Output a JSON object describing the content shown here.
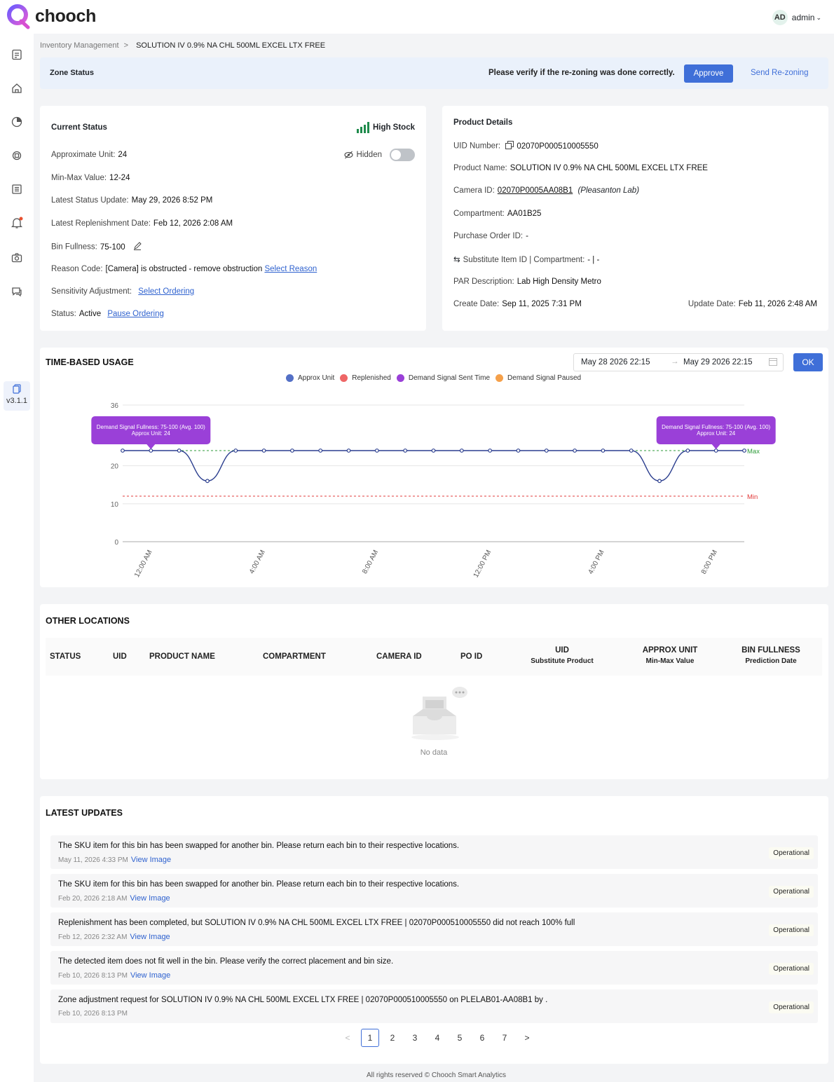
{
  "app": {
    "logo_text": "chooch",
    "user_initials": "AD",
    "user_name": "admin",
    "version": "v3.1.1"
  },
  "breadcrumb": {
    "parent": "Inventory Management",
    "separator": ">",
    "current": "SOLUTION IV 0.9% NA CHL 500ML EXCEL LTX FREE"
  },
  "zone_status": {
    "title": "Zone Status",
    "message": "Please verify if the re-zoning was done correctly.",
    "approve_label": "Approve",
    "send_label": "Send Re-zoning"
  },
  "current_status": {
    "title": "Current Status",
    "stock_label": "High Stock",
    "hidden_label": "Hidden",
    "approx_unit_label": "Approximate Unit:",
    "approx_unit": "24",
    "minmax_label": "Min-Max Value:",
    "minmax": "12-24",
    "latest_update_label": "Latest Status Update:",
    "latest_update": "May 29, 2026 8:52 PM",
    "replenish_label": "Latest Replenishment Date:",
    "replenish": "Feb 12, 2026 2:08 AM",
    "fullness_label": "Bin Fullness:",
    "fullness": "75-100",
    "reason_label": "Reason Code:",
    "reason": "[Camera] is obstructed - remove obstruction",
    "reason_link": "Select Reason",
    "sensitivity_label": "Sensitivity Adjustment:",
    "sensitivity_link": "Select Ordering",
    "status_label": "Status:",
    "status": "Active",
    "status_link": "Pause Ordering"
  },
  "product_details": {
    "title": "Product Details",
    "uid_label": "UID Number:",
    "uid": "02070P000510005550",
    "name_label": "Product Name:",
    "name": "SOLUTION IV 0.9% NA CHL 500ML EXCEL LTX FREE",
    "camera_label": "Camera ID:",
    "camera": "02070P0005AA08B1",
    "camera_location": "(Pleasanton Lab)",
    "compartment_label": "Compartment:",
    "compartment": "AA01B25",
    "po_label": "Purchase Order ID:",
    "po": "-",
    "substitute_label": "Substitute Item ID | Compartment:",
    "substitute": "- | -",
    "par_label": "PAR Description:",
    "par": "Lab High Density Metro",
    "create_label": "Create Date:",
    "create": "Sep 11, 2025 7:31 PM",
    "update_label": "Update Date:",
    "update": "Feb 11, 2026 2:48 AM"
  },
  "usage": {
    "title": "TIME-BASED USAGE",
    "date_from": "May 28 2026 22:15",
    "date_to": "May 29 2026 22:15",
    "ok_label": "OK"
  },
  "chart_data": {
    "type": "line",
    "legend": [
      "Approx Unit",
      "Replenished",
      "Demand Signal Sent Time",
      "Demand Signal Paused"
    ],
    "legend_colors": [
      "#5470c6",
      "#ee6666",
      "#9a40d8",
      "#f5a04a"
    ],
    "x_ticks": [
      "12:00 AM",
      "4:00 AM",
      "8:00 AM",
      "12:00 PM",
      "4:00 PM",
      "8:00 PM"
    ],
    "y_ticks": [
      "0",
      "10",
      "20",
      "36"
    ],
    "ylim": [
      0,
      36
    ],
    "series": [
      {
        "name": "Approx Unit",
        "values": [
          24,
          24,
          24,
          16,
          24,
          24,
          24,
          24,
          24,
          24,
          24,
          24,
          24,
          24,
          24,
          24,
          24,
          24,
          24,
          16,
          24,
          24,
          24
        ]
      }
    ],
    "max_line": {
      "value": 24,
      "label": "Max"
    },
    "min_line": {
      "value": 12,
      "label": "Min"
    },
    "tooltips": [
      {
        "index": 1,
        "line1": "Demand Signal Fullness: 75-100 (Avg. 100)",
        "line2": "Approx Unit: 24"
      },
      {
        "index": 21,
        "line1": "Demand Signal Fullness: 75-100 (Avg. 100)",
        "line2": "Approx Unit: 24"
      }
    ]
  },
  "other_locations": {
    "title": "OTHER LOCATIONS",
    "columns": [
      "STATUS",
      "UID",
      "PRODUCT NAME",
      "COMPARTMENT",
      "CAMERA ID",
      "PO ID"
    ],
    "uid_col": {
      "main": "UID",
      "sub": "Substitute Product"
    },
    "approx_col": {
      "main": "APPROX UNIT",
      "sub": "Min-Max Value"
    },
    "bin_col": {
      "main": "BIN FULLNESS",
      "sub": "Prediction Date"
    },
    "empty_text": "No data"
  },
  "latest_updates": {
    "title": "LATEST UPDATES",
    "view_label": "View Image",
    "items": [
      {
        "message": "The SKU item for this bin has been swapped for another bin. Please return each bin to their respective locations.",
        "date": "May 11, 2026 4:33 PM",
        "status": "Operational"
      },
      {
        "message": "The SKU item for this bin has been swapped for another bin. Please return each bin to their respective locations.",
        "date": "Feb 20, 2026 2:18 AM",
        "status": "Operational"
      },
      {
        "message": "Replenishment has been completed, but SOLUTION IV 0.9% NA CHL 500ML EXCEL LTX FREE | 02070P000510005550 did not reach 100% full",
        "date": "Feb 12, 2026 2:32 AM",
        "status": "Operational"
      },
      {
        "message": "The detected item does not fit well in the bin. Please verify the correct placement and bin size.",
        "date": "Feb 10, 2026 8:13 PM",
        "status": "Operational"
      },
      {
        "message": "Zone adjustment request for SOLUTION IV 0.9% NA CHL 500ML EXCEL LTX FREE | 02070P000510005550 on PLELAB01-AA08B1 by .",
        "date": "Feb 10, 2026 8:13 PM",
        "status": "Operational"
      }
    ],
    "pages": [
      "1",
      "2",
      "3",
      "4",
      "5",
      "6",
      "7"
    ],
    "prev": "<",
    "next": ">"
  },
  "footer": "All rights reserved © Chooch Smart Analytics"
}
